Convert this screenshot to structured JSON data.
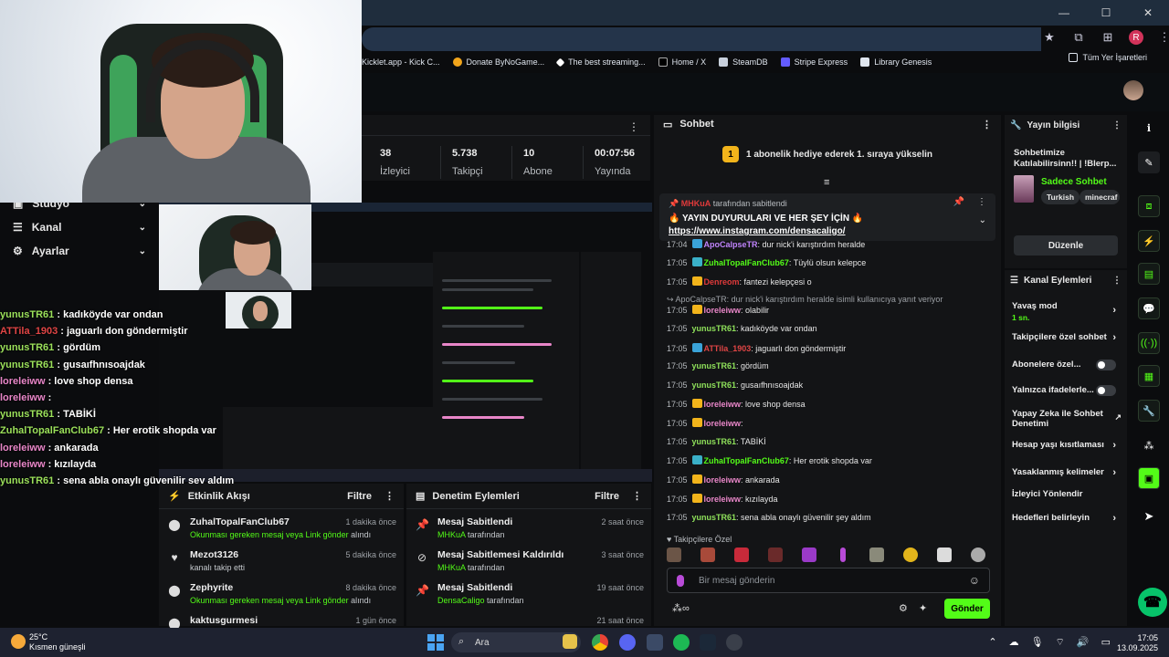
{
  "window": {
    "minimize": "—",
    "maximize": "☐",
    "close": "✕"
  },
  "bookmarks": [
    {
      "label": "Kicklet.app - Kick C..."
    },
    {
      "label": "Donate ByNoGame..."
    },
    {
      "label": "The best streaming..."
    },
    {
      "label": "Home / X"
    },
    {
      "label": "SteamDB"
    },
    {
      "label": "Stripe Express"
    },
    {
      "label": "Library Genesis"
    }
  ],
  "bookmarks_all": "Tüm Yer İşaretleri",
  "profile_initial": "R",
  "leftnav": {
    "studio": "Stüdyo",
    "channel": "Kanal",
    "settings": "Ayarlar"
  },
  "overlay_chat": [
    {
      "user": "yunusTR61",
      "text": " : kadıköyde var ondan",
      "color": "#9be05a"
    },
    {
      "user": "ATTila_1903",
      "text": " : jaguarlı don göndermiştir",
      "color": "#e04545"
    },
    {
      "user": "yunusTR61",
      "text": " : gördüm",
      "color": "#9be05a"
    },
    {
      "user": "yunusTR61",
      "text": " : gusaıfhnısoajdak",
      "color": "#9be05a"
    },
    {
      "user": "loreleiww",
      "text": " : love shop densa",
      "color": "#e886c8"
    },
    {
      "user": "loreleiww",
      "text": " : ",
      "color": "#e886c8"
    },
    {
      "user": "yunusTR61",
      "text": " : TABİKİ",
      "color": "#9be05a"
    },
    {
      "user": "ZuhalTopalFanClub67",
      "text": " : Her erotik shopda var",
      "color": "#9be05a"
    },
    {
      "user": "loreleiww",
      "text": " : ankarada",
      "color": "#e886c8"
    },
    {
      "user": "loreleiww",
      "text": " : kızılayda",
      "color": "#e886c8"
    },
    {
      "user": "yunusTR61",
      "text": " : sena abla onaylı güvenilir şey aldım",
      "color": "#9be05a"
    }
  ],
  "stats": [
    {
      "value": "38",
      "label": "İzleyici"
    },
    {
      "value": "5.738",
      "label": "Takipçi"
    },
    {
      "value": "10",
      "label": "Abone"
    },
    {
      "value": "00:07:56",
      "label": "Yayında"
    }
  ],
  "activity": {
    "title": "Etkinlik Akışı",
    "filter": "Filtre",
    "items": [
      {
        "name": "ZuhalTopalFanClub67",
        "time": "1 dakika önce",
        "sub_green": "Okunması gereken mesaj veya Link gönder",
        "sub": " alındı",
        "icon": "⬤"
      },
      {
        "name": "Mezot3126",
        "time": "5 dakika önce",
        "sub_green": "",
        "sub": "kanalı takip etti",
        "icon": "♥"
      },
      {
        "name": "Zephyrite",
        "time": "8 dakika önce",
        "sub_green": "Okunması gereken mesaj veya Link gönder",
        "sub": " alındı",
        "icon": "⬤"
      },
      {
        "name": "kaktusgurmesi",
        "time": "1 gün önce",
        "sub_green": "",
        "sub": "",
        "icon": "⬤"
      }
    ]
  },
  "moderation": {
    "title": "Denetim Eylemleri",
    "filter": "Filtre",
    "items": [
      {
        "name": "Mesaj Sabitlendi",
        "time": "2 saat önce",
        "sub_green": "MHKuA",
        "sub": " tarafından",
        "icon": "📌"
      },
      {
        "name": "Mesaj Sabitlemesi Kaldırıldı",
        "time": "3 saat önce",
        "sub_green": "MHKuA",
        "sub": " tarafından",
        "icon": "⊘"
      },
      {
        "name": "Mesaj Sabitlendi",
        "time": "19 saat önce",
        "sub_green": "DensaCaligo",
        "sub": " tarafından",
        "icon": "📌"
      },
      {
        "name": "",
        "time": "21 saat önce",
        "sub_green": "",
        "sub": "",
        "icon": ""
      }
    ]
  },
  "chat": {
    "title": "Sohbet",
    "goal": "1 abonelik hediye ederek 1. sıraya yükselin",
    "goal_badge": "1",
    "pinned": {
      "by_user": "MHKuA",
      "by_text": " tarafından sabitlendi",
      "line1": "🔥 YAYIN DUYURULARI VE HER ŞEY İÇİN 🔥",
      "line2": "https://www.instagram.com/densacaligo/"
    },
    "reply_note": "↪ ApoCalpseTR: dur nick'i karıştırdım heralde isimli kullanıcıya yanıt veriyor",
    "messages": [
      {
        "time": "17:04",
        "user": "ApoCalpseTR",
        "text": ": dur nick'i karıştırdım heralde",
        "color": "#c084fc",
        "badge": "#3aa3d8"
      },
      {
        "time": "17:05",
        "user": "ZuhalTopalFanClub67",
        "text": ": Tüylü olsun kelepce",
        "color": "#53fc18",
        "badge": "#3ab0c8"
      },
      {
        "time": "17:05",
        "user": "Denreom",
        "text": ": fantezi kelepçesi o",
        "color": "#e03a3a",
        "badge": "#f2b41b"
      },
      {
        "time": "17:05",
        "user": "loreleiww",
        "text": ": olabilir",
        "color": "#e886c8",
        "badge": "#f2b41b"
      },
      {
        "time": "17:05",
        "user": "yunusTR61",
        "text": ": kadıköyde var ondan",
        "color": "#8ee05a",
        "badge": ""
      },
      {
        "time": "17:05",
        "user": "ATTila_1903",
        "text": ": jaguarlı don göndermiştir",
        "color": "#e04545",
        "badge": "#3aa3d8"
      },
      {
        "time": "17:05",
        "user": "yunusTR61",
        "text": ": gördüm",
        "color": "#8ee05a",
        "badge": ""
      },
      {
        "time": "17:05",
        "user": "yunusTR61",
        "text": ": gusaıfhnısoajdak",
        "color": "#8ee05a",
        "badge": ""
      },
      {
        "time": "17:05",
        "user": "loreleiww",
        "text": ": love shop densa",
        "color": "#e886c8",
        "badge": "#f2b41b"
      },
      {
        "time": "17:05",
        "user": "loreleiww",
        "text": ":",
        "color": "#e886c8",
        "badge": "#f2b41b"
      },
      {
        "time": "17:05",
        "user": "yunusTR61",
        "text": ": TABİKİ",
        "color": "#8ee05a",
        "badge": ""
      },
      {
        "time": "17:05",
        "user": "ZuhalTopalFanClub67",
        "text": ": Her erotik shopda var",
        "color": "#53fc18",
        "badge": "#3ab0c8"
      },
      {
        "time": "17:05",
        "user": "loreleiww",
        "text": ": ankarada",
        "color": "#e886c8",
        "badge": "#f2b41b"
      },
      {
        "time": "17:05",
        "user": "loreleiww",
        "text": ": kızılayda",
        "color": "#e886c8",
        "badge": "#f2b41b"
      },
      {
        "time": "17:05",
        "user": "yunusTR61",
        "text": ": sena abla onaylı güvenilir şey aldım",
        "color": "#8ee05a",
        "badge": ""
      }
    ],
    "followers_label": "♥ Takipçilere Özel",
    "input_placeholder": "Bir mesaj gönderin",
    "send": "Gönder"
  },
  "info": {
    "title": "Yayın bilgisi",
    "stream_title": "Sohbetimize Katılabilirsinn!! | !Blerp...",
    "category": "Sadece Sohbet",
    "tags": [
      "Turkish",
      "minecraf"
    ],
    "edit": "Düzenle"
  },
  "actions": {
    "title": "Kanal Eylemleri",
    "slow_mode": "Yavaş mod",
    "slow_value": "1 sn.",
    "followers_only": "Takipçilere özel sohbet",
    "subs_only": "Abonelere özel...",
    "emotes_only": "Yalnızca ifadelerle...",
    "ai_mod": "Yapay Zeka ile Sohbet Denetimi",
    "age": "Hesap yaşı kısıtlaması",
    "banned_words": "Yasaklanmış kelimeler",
    "viewer_redirect": "İzleyici Yönlendir",
    "goals": "Hedefleri belirleyin"
  },
  "taskbar": {
    "temp": "25°C",
    "weather": "Kısmen güneşli",
    "search": "Ara",
    "time": "17:05",
    "date": "13.09.2025"
  },
  "colors": {
    "accent": "#53fc18",
    "panel": "#131416",
    "background": "#0b0c0e"
  }
}
